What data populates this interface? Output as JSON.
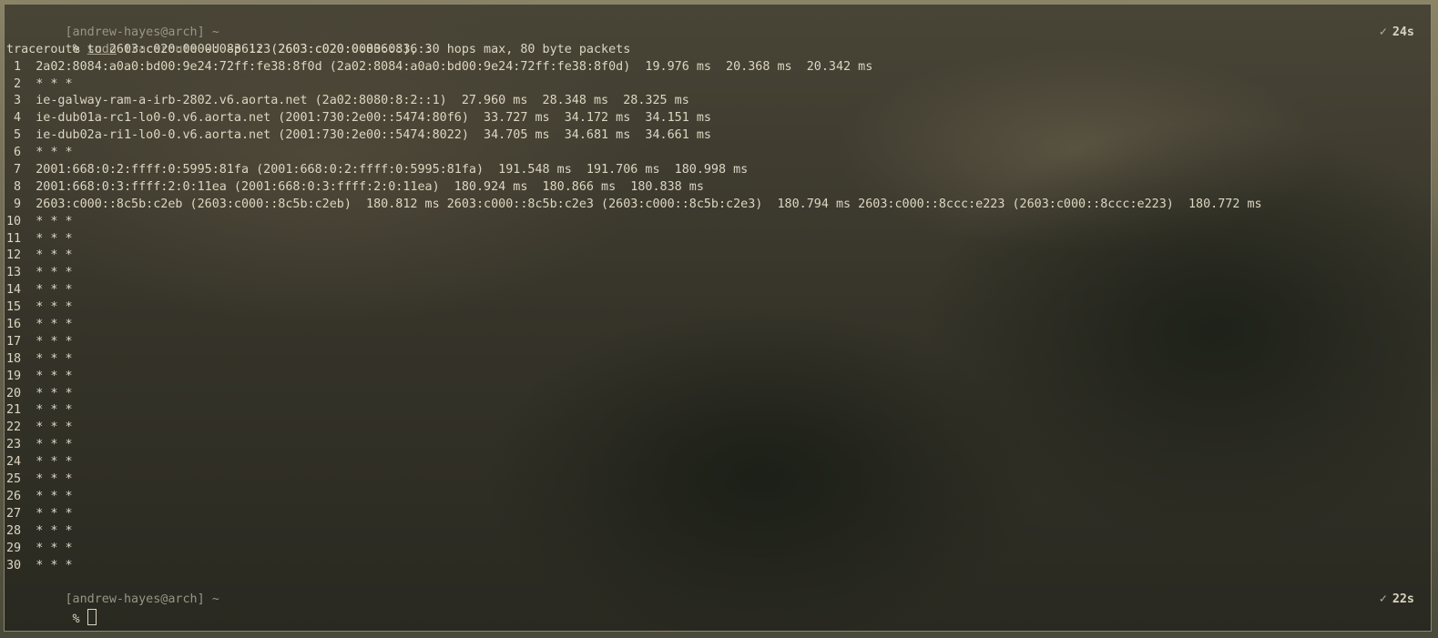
{
  "terminal": {
    "prompt1": {
      "header": "[andrew-hayes@arch] ~",
      "symbol": " % ",
      "cmd_sudo": "sudo",
      "cmd_traceroute": "traceroute",
      "cmd_args": " -U -p 123 2603:c020:0000:0836::",
      "check": "✓",
      "duration": "24s"
    },
    "output": [
      "traceroute to 2603:c020:0000:0836:: (2603:c020:0:836::), 30 hops max, 80 byte packets",
      " 1  2a02:8084:a0a0:bd00:9e24:72ff:fe38:8f0d (2a02:8084:a0a0:bd00:9e24:72ff:fe38:8f0d)  19.976 ms  20.368 ms  20.342 ms",
      " 2  * * *",
      " 3  ie-galway-ram-a-irb-2802.v6.aorta.net (2a02:8080:8:2::1)  27.960 ms  28.348 ms  28.325 ms",
      " 4  ie-dub01a-rc1-lo0-0.v6.aorta.net (2001:730:2e00::5474:80f6)  33.727 ms  34.172 ms  34.151 ms",
      " 5  ie-dub02a-ri1-lo0-0.v6.aorta.net (2001:730:2e00::5474:8022)  34.705 ms  34.681 ms  34.661 ms",
      " 6  * * *",
      " 7  2001:668:0:2:ffff:0:5995:81fa (2001:668:0:2:ffff:0:5995:81fa)  191.548 ms  191.706 ms  180.998 ms",
      " 8  2001:668:0:3:ffff:2:0:11ea (2001:668:0:3:ffff:2:0:11ea)  180.924 ms  180.866 ms  180.838 ms",
      " 9  2603:c000::8c5b:c2eb (2603:c000::8c5b:c2eb)  180.812 ms 2603:c000::8c5b:c2e3 (2603:c000::8c5b:c2e3)  180.794 ms 2603:c000::8ccc:e223 (2603:c000::8ccc:e223)  180.772 ms",
      "10  * * *",
      "11  * * *",
      "12  * * *",
      "13  * * *",
      "14  * * *",
      "15  * * *",
      "16  * * *",
      "17  * * *",
      "18  * * *",
      "19  * * *",
      "20  * * *",
      "21  * * *",
      "22  * * *",
      "23  * * *",
      "24  * * *",
      "25  * * *",
      "26  * * *",
      "27  * * *",
      "28  * * *",
      "29  * * *",
      "30  * * *"
    ],
    "prompt2": {
      "header": "[andrew-hayes@arch] ~",
      "symbol": " % ",
      "check": "✓",
      "duration": "22s"
    }
  }
}
